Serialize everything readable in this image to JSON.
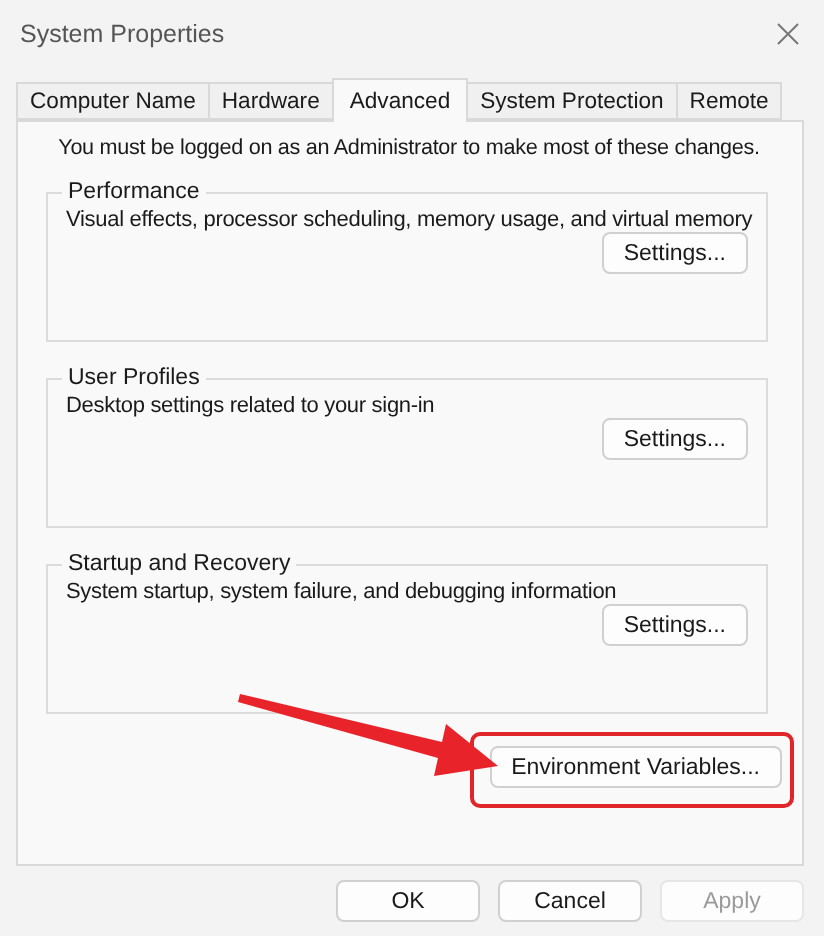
{
  "window": {
    "title": "System Properties"
  },
  "tabs": [
    {
      "label": "Computer Name",
      "selected": false
    },
    {
      "label": "Hardware",
      "selected": false
    },
    {
      "label": "Advanced",
      "selected": true
    },
    {
      "label": "System Protection",
      "selected": false
    },
    {
      "label": "Remote",
      "selected": false
    }
  ],
  "notice": "You must be logged on as an Administrator to make most of these changes.",
  "groups": [
    {
      "title": "Performance",
      "description": "Visual effects, processor scheduling, memory usage, and virtual memory",
      "button": "Settings..."
    },
    {
      "title": "User Profiles",
      "description": "Desktop settings related to your sign-in",
      "button": "Settings..."
    },
    {
      "title": "Startup and Recovery",
      "description": "System startup, system failure, and debugging information",
      "button": "Settings..."
    }
  ],
  "environment_button": {
    "label": "Environment Variables...",
    "highlighted": true
  },
  "footer_buttons": [
    {
      "label": "OK",
      "disabled": false
    },
    {
      "label": "Cancel",
      "disabled": false
    },
    {
      "label": "Apply",
      "disabled": true
    }
  ]
}
